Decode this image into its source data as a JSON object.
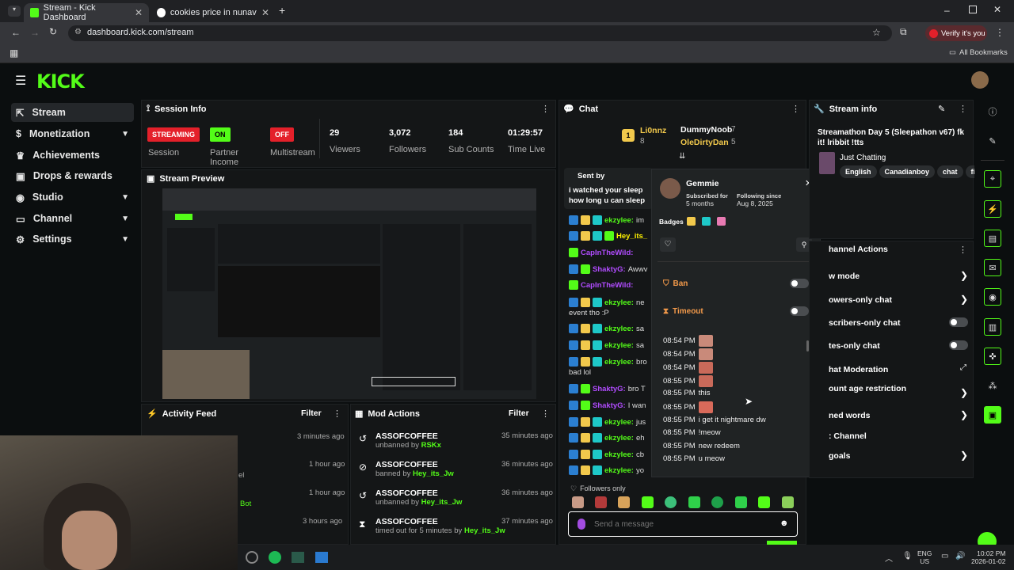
{
  "browser": {
    "tabs": [
      {
        "title": "Stream - Kick Dashboard",
        "active": true
      },
      {
        "title": "cookies price in nunavut - Goo",
        "active": false
      }
    ],
    "url": "dashboard.kick.com/stream",
    "verify_label": "Verify it's you",
    "bookmarks_label": "All Bookmarks"
  },
  "sidebar": {
    "items": [
      {
        "label": "Stream"
      },
      {
        "label": "Monetization"
      },
      {
        "label": "Achievements"
      },
      {
        "label": "Drops & rewards"
      },
      {
        "label": "Studio"
      },
      {
        "label": "Channel"
      },
      {
        "label": "Settings"
      }
    ]
  },
  "session_info": {
    "title": "Session Info",
    "session": {
      "badge": "STREAMING",
      "label": "Session"
    },
    "partner": {
      "badge": "ON",
      "label": "Partner Income"
    },
    "multistream": {
      "badge": "OFF",
      "label": "Multistream"
    },
    "viewers": {
      "value": "29",
      "label": "Viewers"
    },
    "followers": {
      "value": "3,072",
      "label": "Followers"
    },
    "subs": {
      "value": "184",
      "label": "Sub Counts"
    },
    "time": {
      "value": "01:29:57",
      "label": "Time Live"
    }
  },
  "preview": {
    "title": "Stream Preview"
  },
  "activity": {
    "title": "Activity Feed",
    "filter": "Filter",
    "items": [
      {
        "time": "3 minutes ago"
      },
      {
        "time": "1 hour ago",
        "text": "el"
      },
      {
        "time": "1 hour ago",
        "text": "Bot"
      },
      {
        "time": "3 hours ago"
      }
    ]
  },
  "mod_actions": {
    "title": "Mod Actions",
    "filter": "Filter",
    "items": [
      {
        "user": "ASSOFCOFFEE",
        "action": "unbanned by",
        "by": "RSKx",
        "time": "35 minutes ago"
      },
      {
        "user": "ASSOFCOFFEE",
        "action": "banned by",
        "by": "Hey_its_Jw",
        "time": "36 minutes ago"
      },
      {
        "user": "ASSOFCOFFEE",
        "action": "unbanned by",
        "by": "Hey_its_Jw",
        "time": "36 minutes ago"
      },
      {
        "user": "ASSOFCOFFEE",
        "action": "timed out for 5 minutes by",
        "by": "Hey_its_Jw",
        "time": "37 minutes ago"
      }
    ]
  },
  "chat": {
    "title": "Chat",
    "gifters": [
      {
        "name": "Li0nnz",
        "count": "8"
      },
      {
        "name": "DummyNoob",
        "count": "7"
      },
      {
        "name": "OleDirtyDan",
        "count": "5"
      }
    ],
    "pinned_label": "Sent by",
    "pinned_text": "i watched your sleep how long u can sleep",
    "lines": [
      {
        "user": "ekzylee:",
        "text": "im",
        "color": "#53fc18"
      },
      {
        "user": "Hey_its_",
        "text": "",
        "color": "#fff200"
      },
      {
        "user": "CapInTheWild:",
        "text": "",
        "color": "#b14cff"
      },
      {
        "user": "ShaktyG:",
        "text": "Awwv",
        "color": "#b14cff"
      },
      {
        "user": "CapInTheWild:",
        "text": "",
        "color": "#b14cff"
      },
      {
        "user": "ekzylee:",
        "text": "ne",
        "color": "#53fc18"
      },
      {
        "user": "",
        "text": "event tho :P",
        "color": "#ddd"
      },
      {
        "user": "ekzylee:",
        "text": "sa",
        "color": "#53fc18"
      },
      {
        "user": "ekzylee:",
        "text": "sa",
        "color": "#53fc18"
      },
      {
        "user": "ekzylee:",
        "text": "bro",
        "color": "#53fc18"
      },
      {
        "user": "",
        "text": "bad lol",
        "color": "#ddd"
      },
      {
        "user": "ShaktyG:",
        "text": "bro T",
        "color": "#b14cff"
      },
      {
        "user": "ShaktyG:",
        "text": "I wan",
        "color": "#b14cff"
      },
      {
        "user": "ekzylee:",
        "text": "jus",
        "color": "#53fc18"
      },
      {
        "user": "ekzylee:",
        "text": "eh",
        "color": "#53fc18"
      },
      {
        "user": "ekzylee:",
        "text": "cb",
        "color": "#53fc18"
      },
      {
        "user": "ekzylee:",
        "text": "yo",
        "color": "#53fc18"
      }
    ],
    "followers_only": "Followers only",
    "input_placeholder": "Send a message"
  },
  "user_popup": {
    "name": "Gemmie",
    "subscribed_label": "Subscribed for",
    "subscribed_value": "5 months",
    "following_label": "Following since",
    "following_value": "Aug 8, 2025",
    "badges_label": "Badges",
    "ban_label": "Ban",
    "timeout_label": "Timeout",
    "history": [
      {
        "time": "08:54 PM",
        "text": ""
      },
      {
        "time": "08:54 PM",
        "text": ""
      },
      {
        "time": "08:54 PM",
        "text": ""
      },
      {
        "time": "08:55 PM",
        "text": ""
      },
      {
        "time": "08:55 PM",
        "text": "this"
      },
      {
        "time": "08:55 PM",
        "text": ""
      },
      {
        "time": "08:55 PM",
        "text": "i get it nightmare dw"
      },
      {
        "time": "08:55 PM",
        "text": "!meow"
      },
      {
        "time": "08:55 PM",
        "text": "new redeem"
      },
      {
        "time": "08:55 PM",
        "text": "u meow"
      }
    ]
  },
  "stream_info": {
    "title": "Stream info",
    "stream_title": "Streamathon Day 5 (Sleepathon v67) fk it! lribbit !tts",
    "category": "Just Chatting",
    "tags": [
      "English",
      "Canadianboy",
      "chat",
      "fig"
    ]
  },
  "channel_actions": {
    "title": "hannel Actions",
    "items": [
      {
        "label": "w mode",
        "control": "arrow"
      },
      {
        "label": "owers-only chat",
        "control": "arrow"
      },
      {
        "label": "scribers-only chat",
        "control": "toggle"
      },
      {
        "label": "tes-only chat",
        "control": "toggle"
      },
      {
        "label": "hat Moderation",
        "control": "external"
      },
      {
        "label": "ount age restriction",
        "control": "arrow"
      },
      {
        "label": "ned words",
        "control": "arrow"
      },
      {
        "label": ": Channel",
        "control": "none"
      },
      {
        "label": "goals",
        "control": "arrow"
      }
    ]
  },
  "system_tray": {
    "lang": "ENG",
    "region": "US",
    "time": "10:02 PM",
    "date": "2026-01-02"
  },
  "colors": {
    "kick_green": "#53fc18",
    "live_red": "#e4202a",
    "panel_bg": "#141617",
    "page_bg": "#0b0e0f"
  }
}
